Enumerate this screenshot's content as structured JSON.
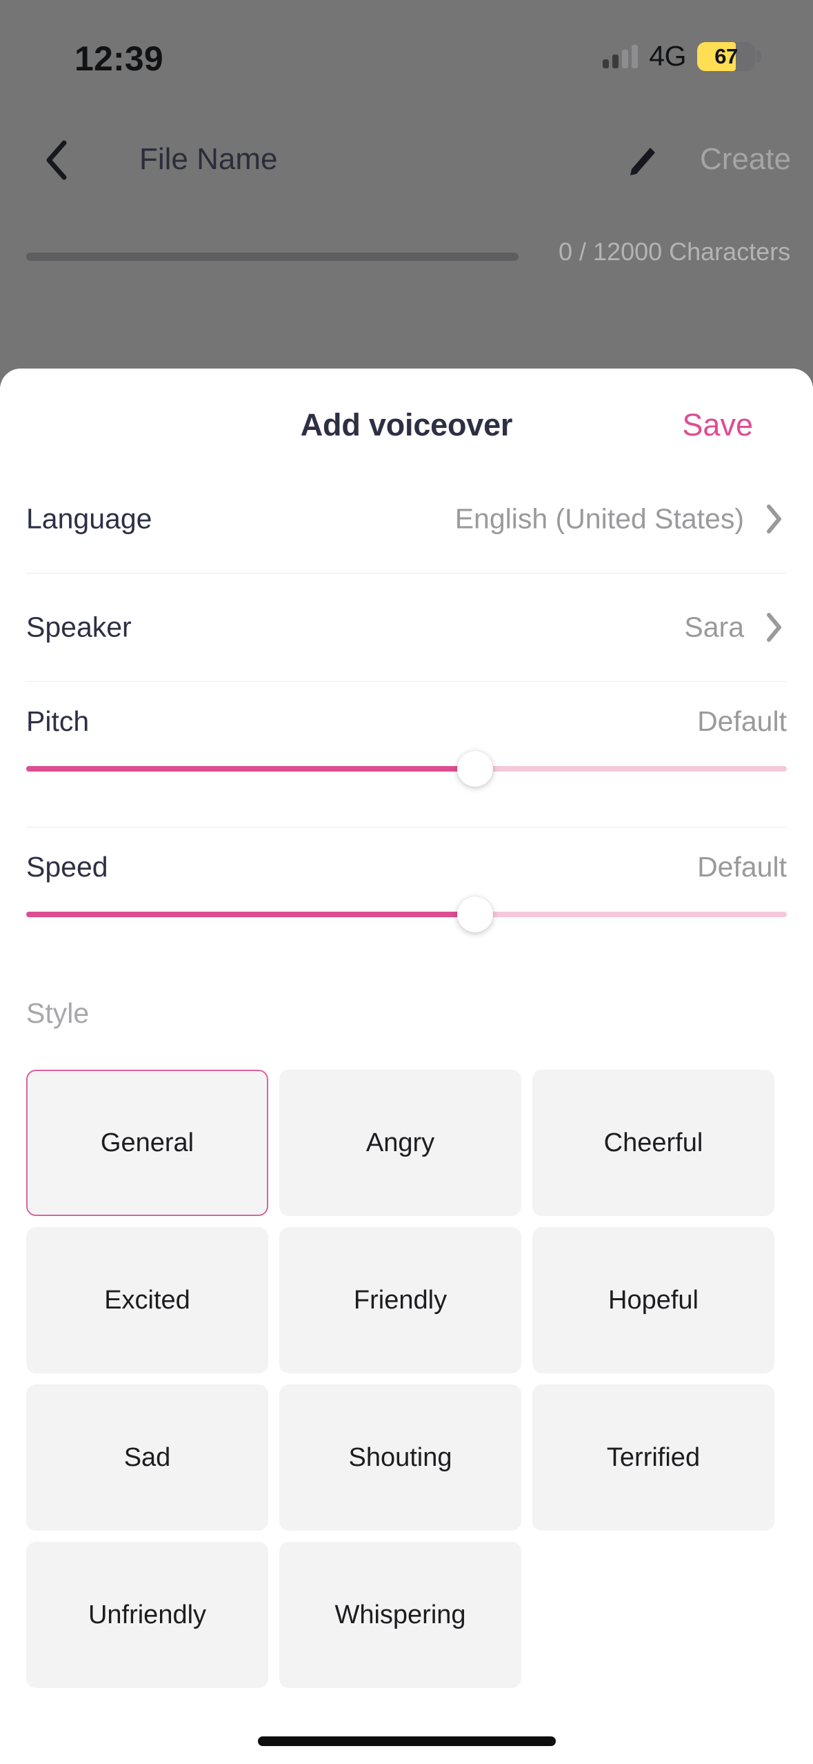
{
  "status_bar": {
    "time": "12:39",
    "network": "4G",
    "battery_level": "67",
    "battery_percent": 67,
    "signal_bars_filled": 2,
    "signal_bars_total": 4,
    "battery_color": "#FFDE54"
  },
  "app_header": {
    "back_icon": "chevron-left-icon",
    "file_name": "File Name",
    "edit_icon": "pencil-icon",
    "create_label": "Create"
  },
  "char_counter": {
    "text": "0 / 12000 Characters",
    "used": 0,
    "max": 12000
  },
  "sheet": {
    "title": "Add voiceover",
    "save_label": "Save",
    "accent_color": "#DE4D93",
    "rows": [
      {
        "label": "Language",
        "value": "English (United States)",
        "chevron_icon": "chevron-right-icon"
      },
      {
        "label": "Speaker",
        "value": "Sara",
        "chevron_icon": "chevron-right-icon"
      }
    ],
    "sliders": [
      {
        "label": "Pitch",
        "state": "Default",
        "percent": 59,
        "track_color": "#F5C8DC",
        "fill_color": "#DD4D92"
      },
      {
        "label": "Speed",
        "state": "Default",
        "percent": 59,
        "track_color": "#F5C8DC",
        "fill_color": "#DD4D92"
      }
    ],
    "style": {
      "label": "Style",
      "selected": "General",
      "options": [
        "General",
        "Angry",
        "Cheerful",
        "Excited",
        "Friendly",
        "Hopeful",
        "Sad",
        "Shouting",
        "Terrified",
        "Unfriendly",
        "Whispering"
      ]
    }
  }
}
